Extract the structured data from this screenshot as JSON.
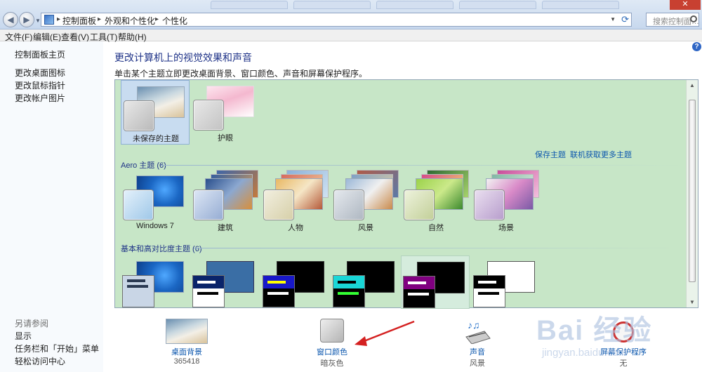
{
  "address_bar": {
    "breadcrumbs": [
      "控制面板",
      "外观和个性化",
      "个性化"
    ],
    "search_placeholder": "搜索控制面…",
    "back_icon": "back-arrow-icon",
    "forward_icon": "forward-arrow-icon"
  },
  "menu": [
    "文件(F)",
    "编辑(E)",
    "查看(V)",
    "工具(T)",
    "帮助(H)"
  ],
  "sidebar": {
    "home": "控制面板主页",
    "links": [
      "更改桌面图标",
      "更改鼠标指针",
      "更改帐户图片"
    ],
    "see_also_title": "另请参阅",
    "see_also": [
      "显示",
      "任务栏和「开始」菜单",
      "轻松访问中心"
    ]
  },
  "main": {
    "title": "更改计算机上的视觉效果和声音",
    "subtitle": "单击某个主题立即更改桌面背景、窗口颜色、声音和屏幕保护程序。",
    "my_themes": [
      {
        "label": "未保存的主题",
        "selected": true
      },
      {
        "label": "护眼",
        "selected": false
      }
    ],
    "save_theme": "保存主题",
    "get_more": "联机获取更多主题",
    "aero_group": "Aero 主题 (6)",
    "aero_themes": [
      "Windows 7",
      "建筑",
      "人物",
      "风景",
      "自然",
      "场景"
    ],
    "basic_group": "基本和高对比度主题 (6)"
  },
  "bottom": [
    {
      "label": "桌面背景",
      "value": "365418",
      "icon": "desktop-background-icon"
    },
    {
      "label": "窗口颜色",
      "value": "暗灰色",
      "icon": "window-color-icon"
    },
    {
      "label": "声音",
      "value": "风景",
      "icon": "sound-icon"
    },
    {
      "label": "屏幕保护程序",
      "value": "无",
      "icon": "screensaver-icon"
    }
  ],
  "watermark": {
    "text": "Bai 经验",
    "url": "jingyan.baidu.com"
  },
  "colors": {
    "panel": "#c7e6c7",
    "link": "#0c57ae",
    "title": "#1e3287",
    "arrow": "#d42020"
  }
}
